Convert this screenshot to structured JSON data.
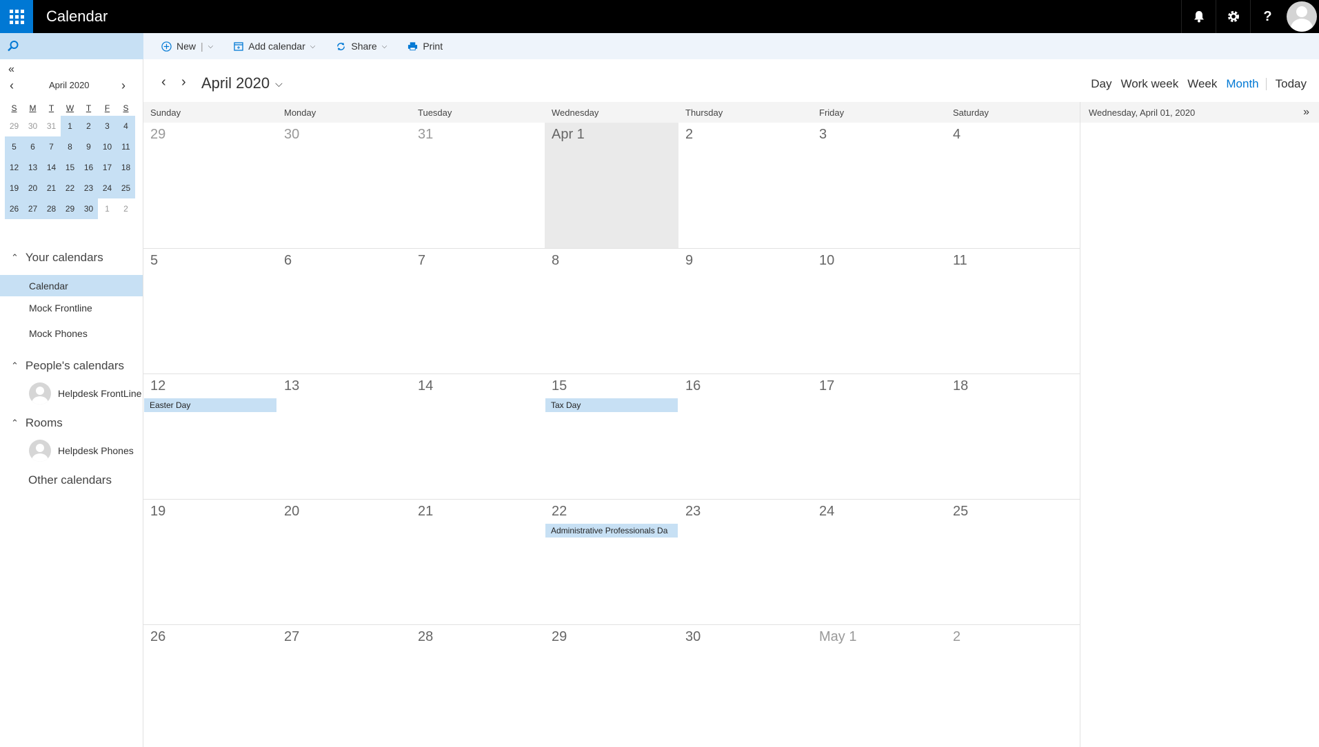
{
  "app": {
    "title": "Calendar"
  },
  "toolbar": {
    "new_label": "New",
    "add_calendar_label": "Add calendar",
    "share_label": "Share",
    "print_label": "Print"
  },
  "mini_calendar": {
    "title": "April 2020",
    "dow": [
      "S",
      "M",
      "T",
      "W",
      "T",
      "F",
      "S"
    ],
    "weeks": [
      [
        "29",
        "30",
        "31",
        "1",
        "2",
        "3",
        "4"
      ],
      [
        "5",
        "6",
        "7",
        "8",
        "9",
        "10",
        "11"
      ],
      [
        "12",
        "13",
        "14",
        "15",
        "16",
        "17",
        "18"
      ],
      [
        "19",
        "20",
        "21",
        "22",
        "23",
        "24",
        "25"
      ],
      [
        "26",
        "27",
        "28",
        "29",
        "30",
        "1",
        "2"
      ]
    ]
  },
  "sidebar": {
    "your_calendars": "Your calendars",
    "calendars": [
      "Calendar",
      "Mock Frontline",
      "Mock Phones"
    ],
    "peoples_calendars": "People's calendars",
    "people": [
      "Helpdesk FrontLine"
    ],
    "rooms": "Rooms",
    "room_items": [
      "Helpdesk Phones"
    ],
    "other_calendars": "Other calendars"
  },
  "header": {
    "month_title": "April 2020",
    "views": [
      "Day",
      "Work week",
      "Week",
      "Month"
    ],
    "selected_view": "Month",
    "today_label": "Today"
  },
  "grid": {
    "dow": [
      "Sunday",
      "Monday",
      "Tuesday",
      "Wednesday",
      "Thursday",
      "Friday",
      "Saturday"
    ],
    "weeks": [
      [
        "29",
        "30",
        "31",
        "Apr 1",
        "2",
        "3",
        "4"
      ],
      [
        "5",
        "6",
        "7",
        "8",
        "9",
        "10",
        "11"
      ],
      [
        "12",
        "13",
        "14",
        "15",
        "16",
        "17",
        "18"
      ],
      [
        "19",
        "20",
        "21",
        "22",
        "23",
        "24",
        "25"
      ],
      [
        "26",
        "27",
        "28",
        "29",
        "30",
        "May 1",
        "2"
      ]
    ],
    "events": {
      "easter": "Easter Day",
      "tax": "Tax Day",
      "admin": "Administrative Professionals Da"
    }
  },
  "right_pane": {
    "date": "Wednesday, April 01, 2020"
  },
  "colors": {
    "accent": "#0078d4",
    "selection": "#c7e0f4",
    "topbar": "#000000"
  }
}
